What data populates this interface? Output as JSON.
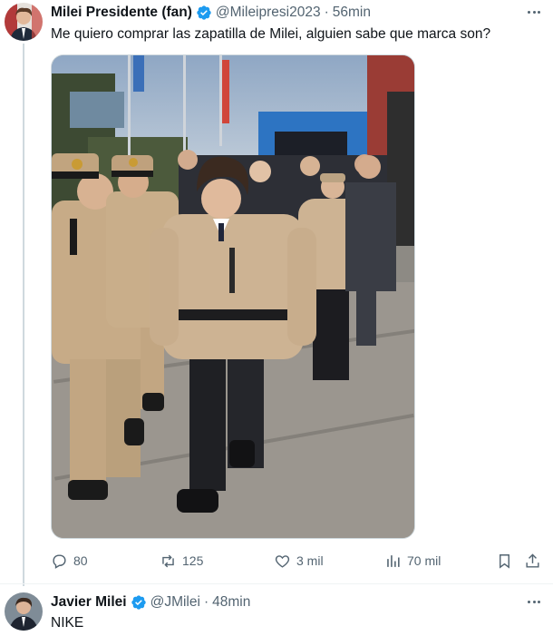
{
  "tweet1": {
    "author_name": "Milei Presidente (fan)",
    "handle": "@Mileipresi2023",
    "separator": "·",
    "time": "56min",
    "text": "Me quiero comprar las zapatilla de Milei, alguien sabe que marca son?",
    "actions": {
      "replies": "80",
      "reposts": "125",
      "likes": "3 mil",
      "views": "70 mil"
    },
    "icons": [
      "reply-icon",
      "repost-icon",
      "like-icon",
      "views-icon",
      "bookmark-icon",
      "share-icon",
      "more-icon",
      "verified-icon"
    ]
  },
  "tweet2": {
    "author_name": "Javier Milei",
    "handle": "@JMilei",
    "separator": "·",
    "time": "48min",
    "text": "NIKE"
  },
  "colors": {
    "verified": "#1d9bf0",
    "secondary_text": "#536471",
    "thread_line": "#cfd9de",
    "jacket": "#cdb393"
  }
}
